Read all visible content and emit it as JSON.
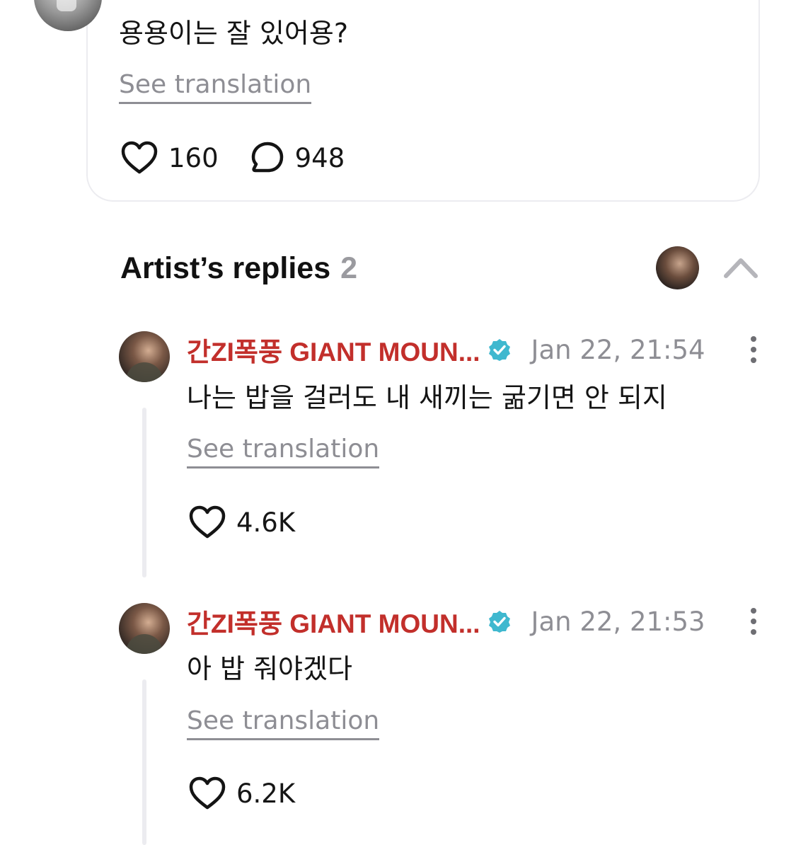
{
  "post": {
    "text": "용용이는 잘 있어용?",
    "see_translation": "See translation",
    "likes": "160",
    "comments": "948"
  },
  "artist_replies": {
    "title": "Artist’s replies",
    "count": "2",
    "replies": [
      {
        "author": "간ZI폭풍 GIANT MOUN...",
        "time": "Jan 22, 21:54",
        "text": "나는 밥을 걸러도 내 새끼는 굶기면 안 되지",
        "see_translation": "See translation",
        "likes": "4.6K"
      },
      {
        "author": "간ZI폭풍 GIANT MOUN...",
        "time": "Jan 22, 21:53",
        "text": "아 밥 줘야겠다",
        "see_translation": "See translation",
        "likes": "6.2K"
      }
    ]
  },
  "colors": {
    "author": "#c22f2b",
    "verified": "#3fb8cf",
    "muted": "#8e8e94",
    "divider": "#ececf0"
  },
  "icons": [
    "heart-icon",
    "comment-icon",
    "verified-badge-icon",
    "more-options-icon",
    "chevron-up-icon"
  ]
}
